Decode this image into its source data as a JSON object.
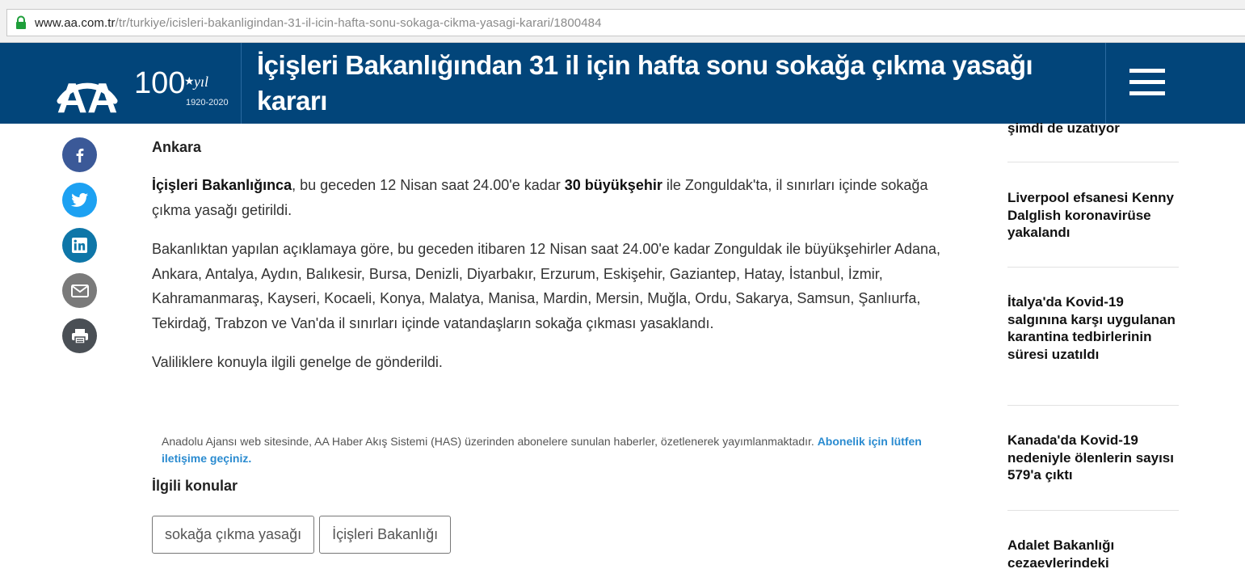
{
  "browser": {
    "url_host": "www.aa.com.tr",
    "url_path": "/tr/turkiye/icisleri-bakanligindan-31-il-icin-hafta-sonu-sokaga-cikma-yasagi-karari/1800484"
  },
  "header": {
    "logo_text": "AA",
    "centenary_number": "100",
    "centenary_word": "yıl",
    "centenary_years": "1920-2020",
    "title": "İçişleri Bakanlığından 31 il için hafta sonu sokağa çıkma yasağı kararı",
    "colors": {
      "header_bg": "#02457a",
      "link": "#2a8bd0"
    }
  },
  "share": {
    "icons": [
      "facebook-icon",
      "twitter-icon",
      "linkedin-icon",
      "mail-icon",
      "print-icon"
    ]
  },
  "article": {
    "dateline": "Ankara",
    "p1_bold1": "İçişleri Bakanlığınca",
    "p1_text1": ", bu geceden 12 Nisan saat 24.00'e kadar ",
    "p1_bold2": "30 büyükşehir",
    "p1_text2": " ile Zonguldak'ta, il sınırları içinde sokağa çıkma yasağı getirildi.",
    "p2": "Bakanlıktan yapılan açıklamaya göre, bu geceden itibaren 12 Nisan saat 24.00'e kadar Zonguldak ile büyükşehirler Adana, Ankara, Antalya, Aydın, Balıkesir, Bursa, Denizli, Diyarbakır, Erzurum, Eskişehir, Gaziantep, Hatay, İstanbul, İzmir, Kahramanmaraş, Kayseri, Kocaeli, Konya, Malatya, Manisa, Mardin, Mersin, Muğla, Ordu, Sakarya, Samsun, Şanlıurfa, Tekirdağ, Trabzon ve Van'da il sınırları içinde vatandaşların sokağa çıkması yasaklandı.",
    "p3": "Valiliklere konuyla ilgili genelge de gönderildi.",
    "notice_text": "Anadolu Ajansı web sitesinde, AA Haber Akış Sistemi (HAS) üzerinden abonelere sunulan haberler, özetlenerek yayımlanmaktadır. ",
    "notice_link": "Abonelik için lütfen iletişime geçiniz.",
    "topics_title": "İlgili konular",
    "tags": [
      "sokağa çıkma yasağı",
      "İçişleri Bakanlığı"
    ]
  },
  "sidebar": {
    "items": [
      "şimdi de uzatıyor",
      "Liverpool efsanesi Kenny Dalglish koronavirüse yakalandı",
      "İtalya'da Kovid-19 salgınına karşı uygulanan karantina tedbirlerinin süresi uzatıldı",
      "Kanada'da Kovid-19 nedeniyle ölenlerin sayısı 579'a çıktı",
      "Adalet Bakanlığı cezaevlerindeki"
    ]
  }
}
